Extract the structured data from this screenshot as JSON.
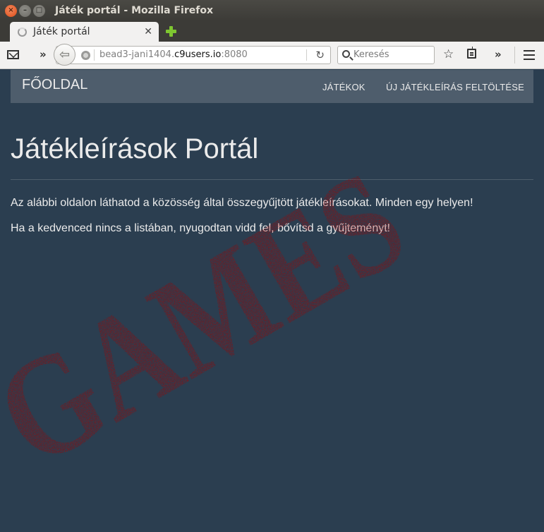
{
  "window": {
    "title": "Játék portál - Mozilla Firefox"
  },
  "tab": {
    "title": "Játék portál",
    "close_glyph": "✕"
  },
  "toolbar": {
    "back_glyph": "⇦",
    "overflow_left": "»",
    "url_prefix": "bead3-jani1404.",
    "url_host": "c9users.io",
    "url_port": ":8080",
    "reload_glyph": "↻",
    "search_placeholder": "Keresés",
    "bookmark_glyph": "☆",
    "overflow_right": "»"
  },
  "site": {
    "brand": "FŐOLDAL",
    "nav": {
      "games": "JÁTÉKOK",
      "upload": "ÚJ JÁTÉKLEÍRÁS FELTÖLTÉSE"
    },
    "heading": "Játékleírások Portál",
    "paragraphs": [
      "Az alábbi oldalon láthatod a közösség által összegyűjtött játékleírásokat. Minden egy helyen!",
      "Ha a kedvenced nincs a listában, nyugodtan vidd fel, bővítsd a gyűjteményt!"
    ],
    "stamp_text": "GAMES"
  },
  "colors": {
    "page_bg": "#2b3e50",
    "navbar_bg": "#4e5d6c",
    "text": "#ebebeb",
    "stamp": "#9b0a0a"
  }
}
